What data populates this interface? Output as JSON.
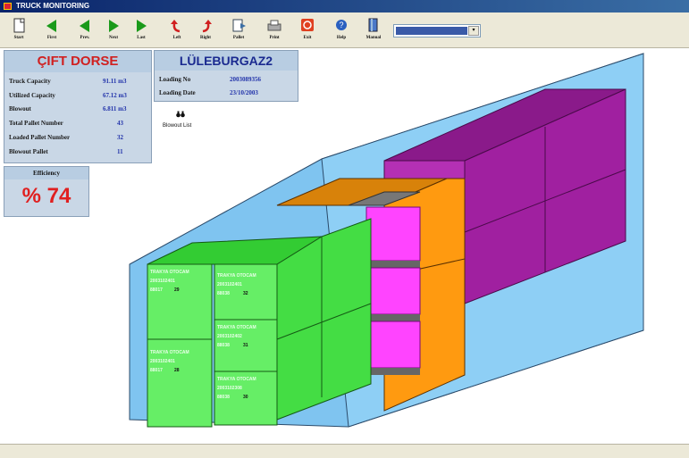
{
  "window": {
    "title": "TRUCK MONITORING"
  },
  "toolbar": {
    "buttons": [
      {
        "label": "Start",
        "icon": "document-icon"
      },
      {
        "label": "First",
        "icon": "first-arrow-icon"
      },
      {
        "label": "Prev.",
        "icon": "prev-arrow-icon"
      },
      {
        "label": "Next",
        "icon": "next-arrow-icon"
      },
      {
        "label": "Last",
        "icon": "last-arrow-icon"
      },
      {
        "label": "Left",
        "icon": "rotate-left-icon"
      },
      {
        "label": "Right",
        "icon": "rotate-right-icon"
      },
      {
        "label": "Pallet",
        "icon": "pallet-icon"
      },
      {
        "label": "Print",
        "icon": "printer-icon"
      },
      {
        "label": "Exit",
        "icon": "exit-icon"
      },
      {
        "label": "Help",
        "icon": "help-icon"
      },
      {
        "label": "Manual",
        "icon": "manual-icon"
      }
    ],
    "select_value": ""
  },
  "truck_panel": {
    "title": "ÇIFT DORSE",
    "rows": [
      {
        "key": "Truck Capacity",
        "value": "91.11 m3"
      },
      {
        "key": "Utilized Capacity",
        "value": "67.12 m3"
      },
      {
        "key": "Blowout",
        "value": "6.811 m3"
      },
      {
        "key": "Total Pallet Number",
        "value": "43"
      },
      {
        "key": "Loaded Pallet Number",
        "value": "32"
      },
      {
        "key": "Blowout Pallet",
        "value": "11"
      }
    ]
  },
  "destination_panel": {
    "title": "LÜLEBURGAZ2",
    "rows": [
      {
        "key": "Loading No",
        "value": "2003089356"
      },
      {
        "key": "Loading Date",
        "value": "23/10/2003"
      }
    ]
  },
  "efficiency_panel": {
    "title": "Efficiency",
    "value": "% 74"
  },
  "blowout_list": {
    "label": "Blowout List",
    "icon": "binoculars-icon"
  },
  "pallets": [
    {
      "company": "TRAKYA OTOCAM",
      "code": "2003102401",
      "product": "88017",
      "no": "29"
    },
    {
      "company": "TRAKYA OTOCAM",
      "code": "2003102401",
      "product": "88017",
      "no": "28"
    },
    {
      "company": "TRAKYA OTOCAM",
      "code": "2003102401",
      "product": "88038",
      "no": "32"
    },
    {
      "company": "TRAKYA OTOCAM",
      "code": "2003102402",
      "product": "88038",
      "no": "31"
    },
    {
      "company": "TRAKYA OTOCAM",
      "code": "2003102308",
      "product": "88038",
      "no": "30"
    }
  ],
  "colors": {
    "trailer": "#7fc4f0",
    "green_front": "#66ee66",
    "green_top": "#33cc33",
    "purple_front": "#a020a0",
    "purple_top": "#8a1a8a",
    "orange": "#ff9a10",
    "magenta": "#ff44ff",
    "efficiency_red": "#e02020"
  }
}
